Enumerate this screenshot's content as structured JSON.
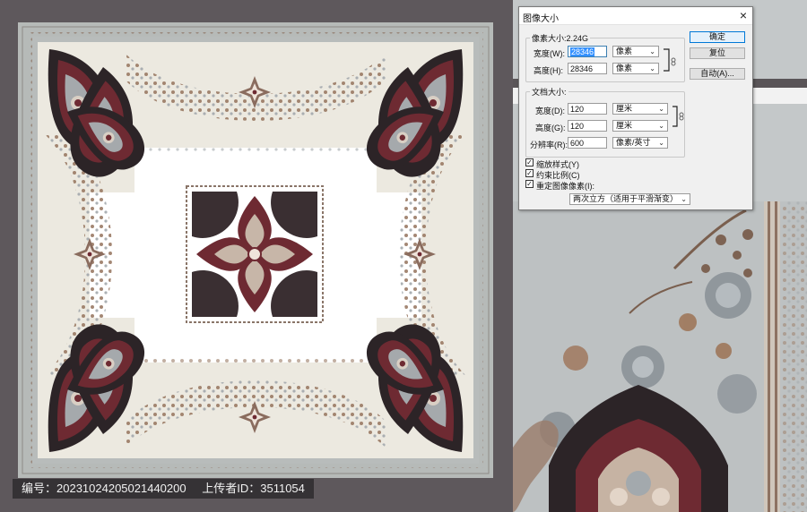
{
  "dialog": {
    "title": "图像大小",
    "close_glyph": "×",
    "pixel_dims_label": "像素大小:2.24G",
    "width_label": "宽度(W):",
    "width_value": "28346",
    "width_unit": "像素",
    "height_label": "高度(H):",
    "height_value": "28346",
    "height_unit": "像素",
    "doc_size_label": "文档大小:",
    "doc_width_label": "宽度(D):",
    "doc_width_value": "120",
    "doc_width_unit": "厘米",
    "doc_height_label": "高度(G):",
    "doc_height_value": "120",
    "doc_height_unit": "厘米",
    "resolution_label": "分辨率(R):",
    "resolution_value": "600",
    "resolution_unit": "像素/英寸",
    "ok_label": "确定",
    "reset_label": "复位",
    "auto_label": "自动(A)...",
    "scale_styles_label": "缩放样式(Y)",
    "constrain_label": "约束比例(C)",
    "resample_label": "重定图像像素(I):",
    "resample_method": "两次立方（适用于平滑渐变）",
    "checkbox_states": {
      "scale_styles": true,
      "constrain": true,
      "resample": true
    }
  },
  "watermark": {
    "id_text": "编号：20231024205021440200",
    "uploader_text": "上传者ID：3511054"
  },
  "colors": {
    "frame_bg": "#5e585c",
    "cream": "#efece3",
    "white_center": "#ffffff",
    "border_gray": "#b6bab8",
    "paisley_dark": "#2c2427",
    "paisley_wine": "#6e2a32",
    "floral_brown": "#9a7a64",
    "floral_gray": "#9ea4a8"
  },
  "icons": {
    "chain": "chain-link-icon",
    "dropdown": "chevron-down-icon",
    "close": "close-icon",
    "check": "checkmark-icon"
  }
}
